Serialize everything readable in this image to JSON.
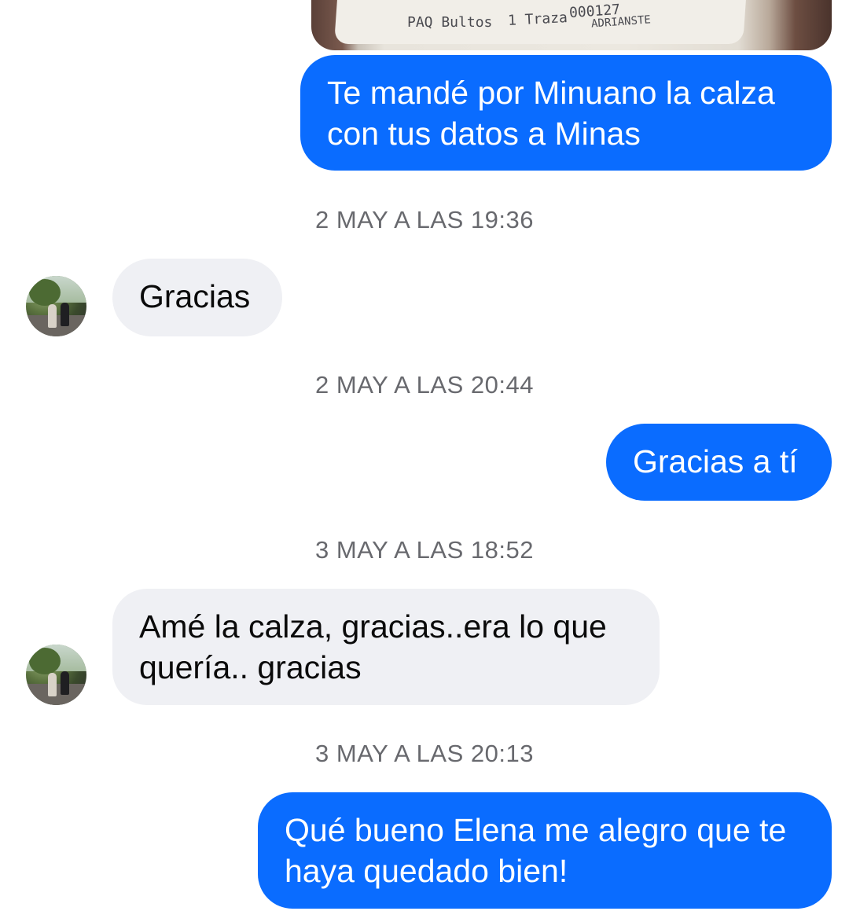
{
  "attachment": {
    "receipt_text_left": "PAQ Bultos",
    "receipt_text_mid": "1 Traza",
    "receipt_text_right": "000127",
    "receipt_text_name": "ADRIANSTE"
  },
  "messages": [
    {
      "type": "out",
      "text": "Te mandé por Minuano la calza con tus datos a Minas"
    },
    {
      "type": "timestamp",
      "text": "2 MAY A LAS 19:36"
    },
    {
      "type": "in",
      "text": "Gracias"
    },
    {
      "type": "timestamp",
      "text": "2 MAY A LAS 20:44"
    },
    {
      "type": "out",
      "text": "Gracias a tí"
    },
    {
      "type": "timestamp",
      "text": "3 MAY A LAS 18:52"
    },
    {
      "type": "in",
      "text": "Amé la calza, gracias..era lo que quería.. gracias"
    },
    {
      "type": "timestamp",
      "text": "3 MAY A LAS 20:13"
    },
    {
      "type": "out",
      "text": "Qué bueno Elena me alegro que te haya quedado bien!"
    }
  ],
  "colors": {
    "outgoing_bubble": "#0a6cff",
    "incoming_bubble": "#eff0f4",
    "timestamp_text": "#68696e"
  }
}
